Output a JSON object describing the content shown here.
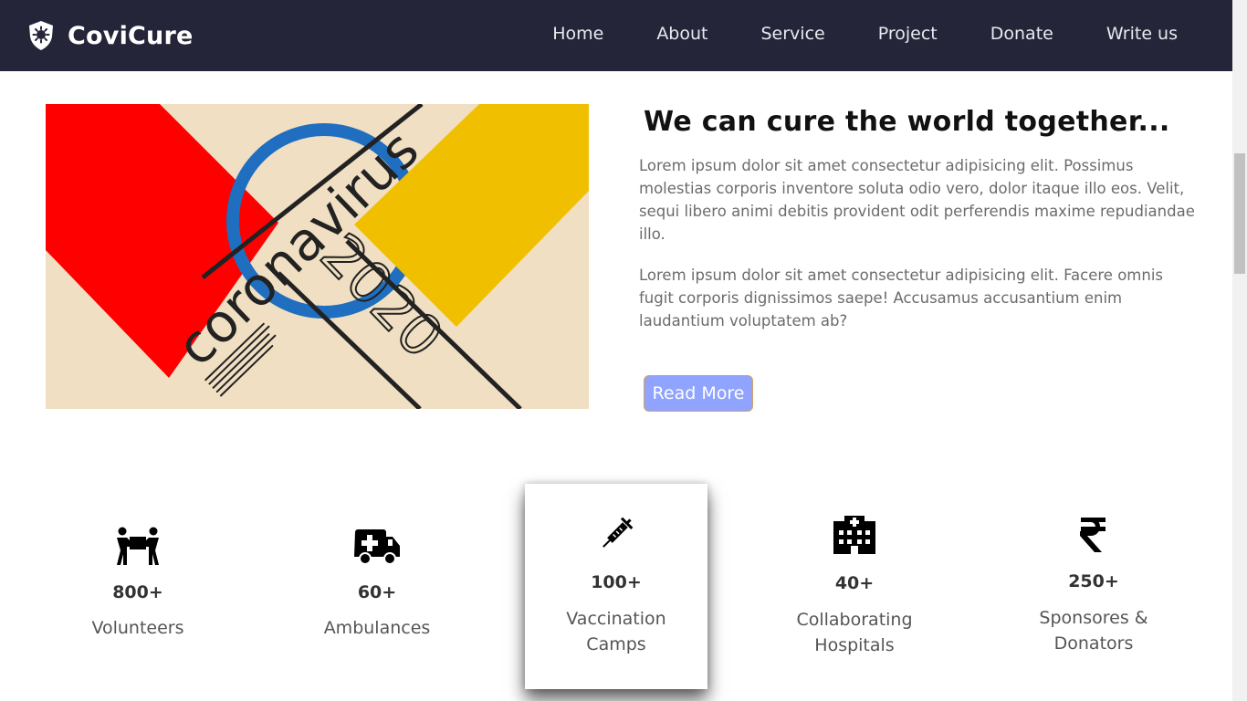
{
  "brand": {
    "name": "CoviCure",
    "icon": "shield-virus-icon"
  },
  "nav": {
    "items": [
      {
        "label": "Home"
      },
      {
        "label": "About"
      },
      {
        "label": "Service"
      },
      {
        "label": "Project"
      },
      {
        "label": "Donate"
      },
      {
        "label": "Write us"
      }
    ]
  },
  "hero": {
    "image": {
      "word": "coronavirus",
      "year": "2020",
      "icon": "coronavirus-poster-image"
    },
    "heading": "We can cure the world together...",
    "paragraphs": [
      "Lorem ipsum dolor sit amet consectetur adipisicing elit. Possimus molestias corporis inventore soluta odio vero, dolor itaque illo eos. Velit, sequi libero animi debitis provident odit perferendis maxime repudiandae illo.",
      "Lorem ipsum dolor sit amet consectetur adipisicing elit. Facere omnis fugit corporis dignissimos saepe! Accusamus accusantium enim laudantium voluptatem ab?"
    ],
    "button": "Read More"
  },
  "stats": [
    {
      "number": "800+",
      "label": "Volunteers",
      "icon": "people-carry-icon"
    },
    {
      "number": "60+",
      "label": "Ambulances",
      "icon": "ambulance-icon"
    },
    {
      "number": "100+",
      "label": "Vaccination Camps",
      "icon": "syringe-icon"
    },
    {
      "number": "40+",
      "label": "Collaborating Hospitals",
      "icon": "hospital-icon"
    },
    {
      "number": "250+",
      "label": "Sponsores & Donators",
      "icon": "rupee-icon"
    }
  ],
  "colors": {
    "navbar": "#25253a",
    "button": "#8fa3ff",
    "poster_red": "#ff0000",
    "poster_yellow": "#f0c000",
    "poster_blue": "#1f6ebf",
    "poster_bg": "#f0dfc2"
  }
}
